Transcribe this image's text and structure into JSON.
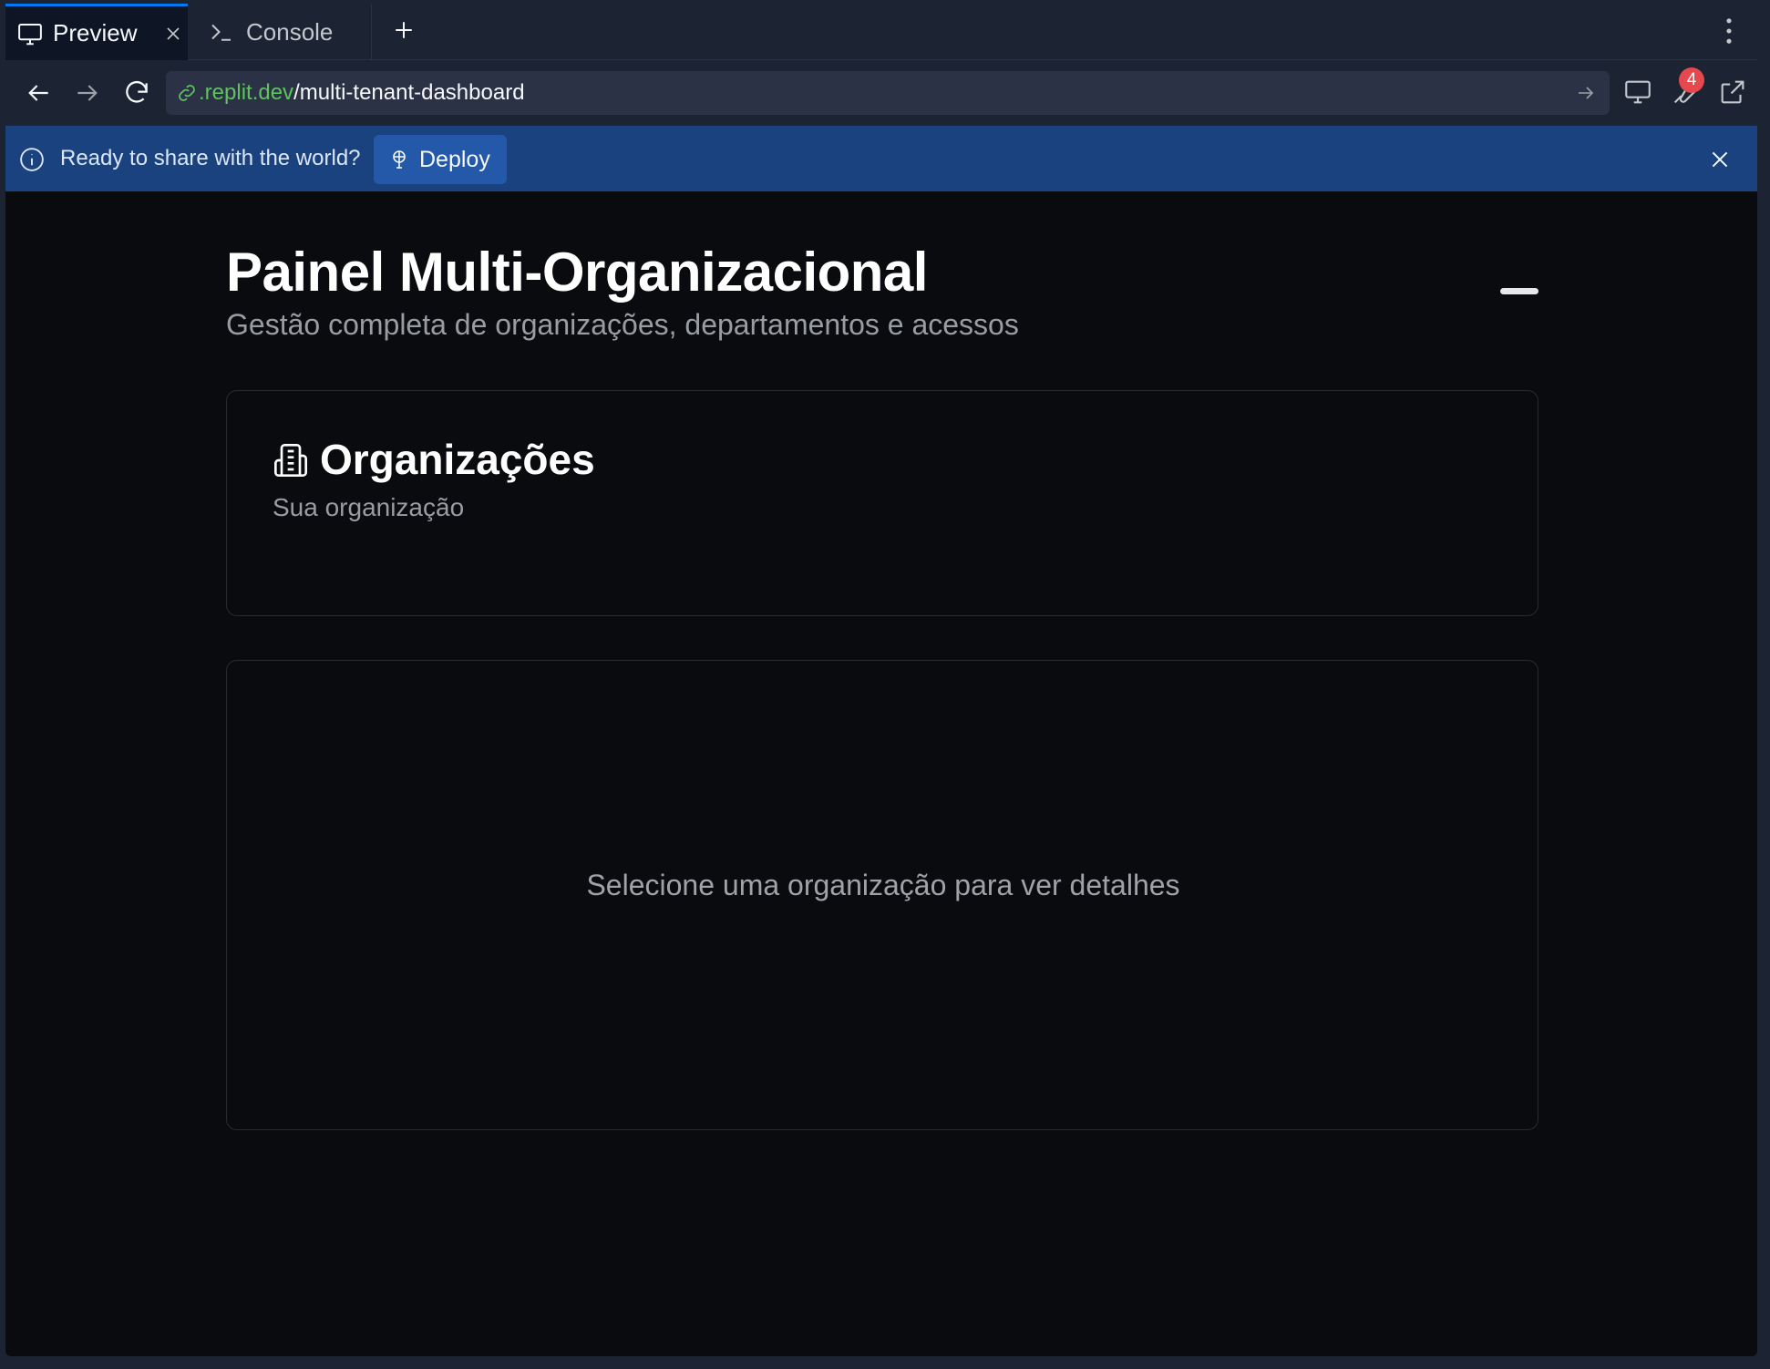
{
  "tabs": [
    {
      "label": "Preview",
      "icon": "monitor-icon",
      "active": true
    },
    {
      "label": "Console",
      "icon": "terminal-icon",
      "active": false
    }
  ],
  "address": {
    "host": ".replit.dev",
    "path": "/multi-tenant-dashboard"
  },
  "devtools_badge": "4",
  "banner": {
    "message": "Ready to share with the world?",
    "deploy_label": "Deploy"
  },
  "page": {
    "title": "Painel Multi-Organizacional",
    "subtitle": "Gestão completa de organizações, departamentos e acessos"
  },
  "organizations_card": {
    "title": "Organizações",
    "description": "Sua organização",
    "icon": "building-icon"
  },
  "details_card": {
    "empty_message": "Selecione uma organização para ver detalhes"
  },
  "colors": {
    "accent": "#0079f2",
    "banner": "#1a427f",
    "url_host": "#5ec35e",
    "badge": "#e5484d"
  }
}
